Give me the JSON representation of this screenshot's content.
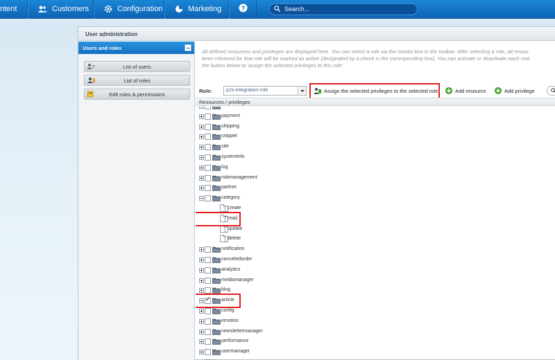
{
  "nav": {
    "items": [
      {
        "label": "ntent",
        "icon": "none"
      },
      {
        "label": "Customers",
        "icon": "users-icon"
      },
      {
        "label": "Configuration",
        "icon": "gear-icon"
      },
      {
        "label": "Marketing",
        "icon": "pie-chart-icon"
      }
    ],
    "help_icon": "question-icon",
    "search_placeholder": "Search..."
  },
  "window": {
    "title": "User administration"
  },
  "left_panel": {
    "header": "Users and roles",
    "buttons": [
      {
        "label": "List of users",
        "icon": "users-list-icon"
      },
      {
        "label": "List of roles",
        "icon": "roles-list-icon"
      },
      {
        "label": "Edit rules & permissions",
        "icon": "edit-rules-icon"
      }
    ]
  },
  "description": [
    "All defined resources and privileges are displayed here. You can select a role via the combo box in the toolbar. After selecting a role, all resour",
    "been released for that role will be marked as active (designated by a check in the corresponding box). You can activate or deactivate each nod",
    "the button below to 'assign the selected privileges to this role'."
  ],
  "toolbar": {
    "role_label": "Role:",
    "role_value": "p2s-integration-role",
    "assign_label": "Assign the selected privileges to the selected role.",
    "add_resource_label": "Add resource",
    "add_privilege_label": "Add privilege"
  },
  "grid": {
    "header": "Resources / privileges",
    "rows": [
      {
        "label": "",
        "type": "folder",
        "level": 0,
        "expanded": false,
        "checked": false
      },
      {
        "label": "payment",
        "type": "folder",
        "level": 0,
        "expanded": false,
        "checked": false
      },
      {
        "label": "shipping",
        "type": "folder",
        "level": 0,
        "expanded": false,
        "checked": false
      },
      {
        "label": "snippet",
        "type": "folder",
        "level": 0,
        "expanded": false,
        "checked": false
      },
      {
        "label": "site",
        "type": "folder",
        "level": 0,
        "expanded": false,
        "checked": false
      },
      {
        "label": "systeminfo",
        "type": "folder",
        "level": 0,
        "expanded": false,
        "checked": false
      },
      {
        "label": "log",
        "type": "folder",
        "level": 0,
        "expanded": false,
        "checked": false
      },
      {
        "label": "riskmanagement",
        "type": "folder",
        "level": 0,
        "expanded": false,
        "checked": false
      },
      {
        "label": "partner",
        "type": "folder",
        "level": 0,
        "expanded": false,
        "checked": false
      },
      {
        "label": "category",
        "type": "folder-open",
        "level": 0,
        "expanded": true,
        "checked": false
      },
      {
        "label": "create",
        "type": "doc",
        "level": 1,
        "checked": false
      },
      {
        "label": "read",
        "type": "doc",
        "level": 1,
        "checked": true
      },
      {
        "label": "update",
        "type": "doc",
        "level": 1,
        "checked": false
      },
      {
        "label": "delete",
        "type": "doc",
        "level": 1,
        "checked": false
      },
      {
        "label": "notification",
        "type": "folder",
        "level": 0,
        "expanded": false,
        "checked": false
      },
      {
        "label": "canceledorder",
        "type": "folder",
        "level": 0,
        "expanded": false,
        "checked": false
      },
      {
        "label": "analytics",
        "type": "folder",
        "level": 0,
        "expanded": false,
        "checked": false
      },
      {
        "label": "mediamanager",
        "type": "folder",
        "level": 0,
        "expanded": false,
        "checked": false
      },
      {
        "label": "blog",
        "type": "folder",
        "level": 0,
        "expanded": false,
        "checked": false
      },
      {
        "label": "article",
        "type": "folder",
        "level": 0,
        "expanded": true,
        "checked": true
      },
      {
        "label": "config",
        "type": "folder",
        "level": 0,
        "expanded": false,
        "checked": false
      },
      {
        "label": "emotion",
        "type": "folder",
        "level": 0,
        "expanded": false,
        "checked": false
      },
      {
        "label": "newslettermanager",
        "type": "folder",
        "level": 0,
        "expanded": false,
        "checked": false
      },
      {
        "label": "performance",
        "type": "folder",
        "level": 0,
        "expanded": false,
        "checked": false
      },
      {
        "label": "usermanager",
        "type": "folder",
        "level": 0,
        "expanded": false,
        "checked": false
      },
      {
        "label": "",
        "type": "folder",
        "level": 0,
        "expanded": false,
        "checked": false
      }
    ]
  },
  "colors": {
    "nav_top": "#1b86d6",
    "nav_bottom": "#0c63b4",
    "panel_header": "#1a7dd0",
    "highlight": "#e02020",
    "add_green": "#3ea024"
  }
}
